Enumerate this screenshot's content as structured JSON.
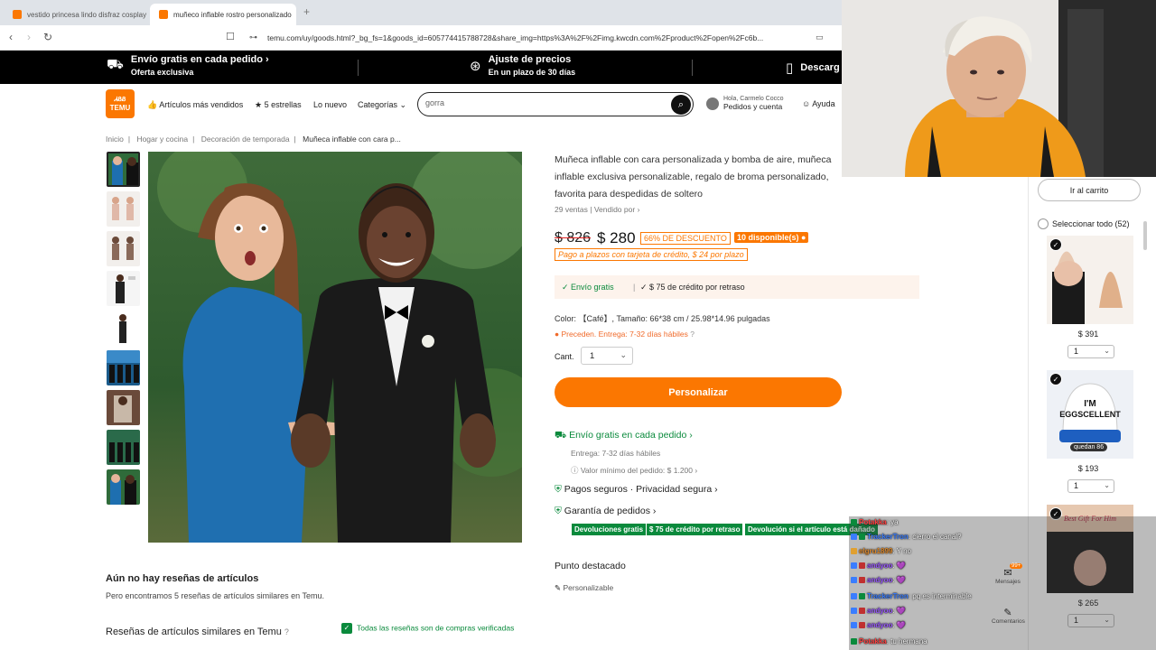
{
  "browser": {
    "tabs": [
      {
        "title": "vestido princesa lindo disfraz cosplay"
      },
      {
        "title": "muñeco inflable rostro personalizado"
      }
    ],
    "url": "temu.com/uy/goods.html?_bg_fs=1&goods_id=605774415788728&share_img=https%3A%2F%2Fimg.kwcdn.com%2Fproduct%2Fopen%2Fc6b..."
  },
  "promo_bar": [
    {
      "title": "Envío gratis en cada pedido ›",
      "subtitle": "Oferta exclusiva",
      "icon": "truck-icon"
    },
    {
      "title": "Ajuste de precios",
      "subtitle": "En un plazo de 30 días",
      "icon": "dollar-clock-icon"
    },
    {
      "title": "Descarg",
      "subtitle": "",
      "icon": "phone-icon"
    }
  ],
  "header": {
    "logo_line1": "ᏗᏰᏰ",
    "logo_line2": "TEMU",
    "nav": [
      "Artículos más vendidos",
      "5 estrellas",
      "Lo nuevo",
      "Categorías"
    ],
    "search_value": "gorra",
    "account_greeting": "Hola, Carmelo Cocco",
    "account_label": "Pedidos y cuenta",
    "help_label": "Ayuda"
  },
  "breadcrumb": [
    "Inicio",
    "Hogar y cocina",
    "Decoración de temporada",
    "Muñeca inflable con cara p..."
  ],
  "product": {
    "title": "Muñeca inflable con cara personalizada y bomba de aire, muñeca inflable exclusiva personalizable, regalo de broma personalizado, favorita para despedidas de soltero",
    "sales": "29 ventas",
    "sold_by": "Vendido por",
    "price_old": "$ 826",
    "price_new": "$ 280",
    "discount": "66% DE DESCUENTO",
    "availability": "10 disponible(s)",
    "installments": "Pago a plazos con tarjeta de crédito, $ 24 por plazo",
    "ship_free": "✓ Envío gratis",
    "late_credit": "✓ $ 75 de crédito por retraso",
    "color": "Color: 【Café】, Tamaño: 66*38 cm / 25.98*14.96 pulgadas",
    "delivery_note": "Preceden. Entrega: 7-32 días hábiles",
    "qty_label": "Cant.",
    "qty_value": "1",
    "customize_button": "Personalizar",
    "free_shipping": "Envío gratis en cada pedido ›",
    "delivery": "Entrega: 7-32 días hábiles",
    "min_order": "Valor mínimo del pedido: $ 1.200 ›",
    "secure": "Pagos seguros · Privacidad segura ›",
    "guarantee": "Garantía de pedidos ›",
    "guarantee_badges": [
      "Devoluciones gratis",
      "$ 75 de crédito por retraso",
      "Devolución si el artículo está dañado"
    ],
    "highlight_title": "Punto destacado",
    "highlight_item": "Personalizable"
  },
  "reviews": {
    "none_title": "Aún no hay reseñas de artículos",
    "found_text": "Pero encontramos 5 reseñas de artículos similares en Temu.",
    "similar_title": "Reseñas de artículos similares en Temu",
    "verified": "Todas las reseñas son de compras verificadas"
  },
  "cart": {
    "go_cart": "Ir al carrito",
    "select_all": "Seleccionar todo (52)",
    "items": [
      {
        "price": "$ 391",
        "qty": "1"
      },
      {
        "price": "$ 193",
        "qty": "1",
        "badge": "quedan 86",
        "hat_text": "I'M EGGSCELLENT"
      },
      {
        "price": "$ 265",
        "qty": "1",
        "overlay": "Best Gift For Him"
      }
    ]
  },
  "chat": {
    "messages": [
      {
        "user": "Potakka",
        "text": "ya",
        "color": "#ff4040"
      },
      {
        "user": "TrackerTron",
        "text": "cierro el canal?",
        "color": "#3a7dff"
      },
      {
        "user": "elgru1899",
        "text": "Y no",
        "color": "#e08a2a"
      },
      {
        "user": "andyoo",
        "text": "💜",
        "color": "#9b59ff"
      },
      {
        "user": "andyoo",
        "text": "💜",
        "color": "#9b59ff"
      },
      {
        "user": "TrackerTron",
        "text": "pq es interminable",
        "color": "#3a7dff"
      },
      {
        "user": "andyoo",
        "text": "💜",
        "color": "#9b59ff"
      },
      {
        "user": "andyoo",
        "text": "💜",
        "color": "#9b59ff"
      },
      {
        "user": "Potakka",
        "text": "tu hermana",
        "color": "#ff4040"
      }
    ],
    "widget_messages": "Mensajes",
    "widget_messages_count": "99+",
    "widget_comments": "Comentarios"
  }
}
